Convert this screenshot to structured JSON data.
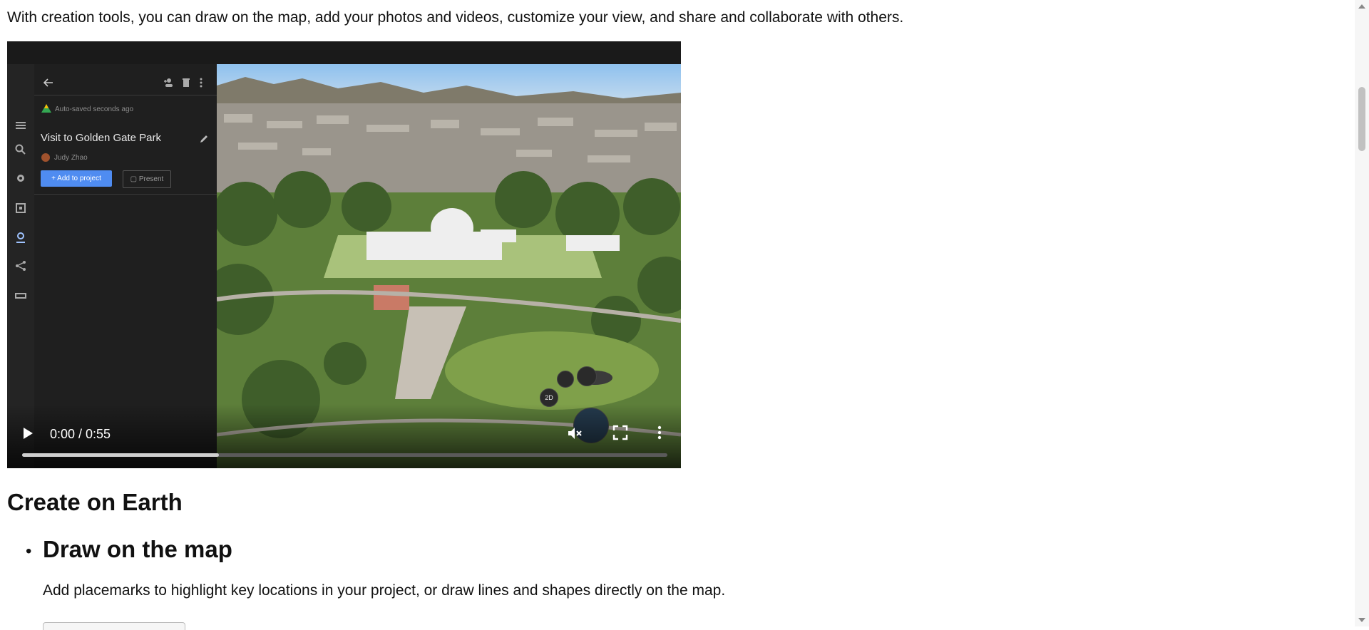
{
  "intro_text": "With creation tools, you can draw on the map, add your photos and videos, customize your view, and share and collaborate with others.",
  "video": {
    "autosave_text": "Auto-saved seconds ago",
    "project_title": "Visit to Golden Gate Park",
    "author": "Judy Zhao",
    "add_to_project_label": "Add to project",
    "present_label": "Present",
    "view_mode_label": "2D",
    "time_display": "0:00 / 0:55",
    "progress_buffered": 0.305,
    "muted": true
  },
  "section": {
    "heading": "Create on Earth",
    "items": [
      {
        "title": "Draw on the map",
        "description": "Add placemarks to highlight key locations in your project, or draw lines and shapes directly on the map."
      }
    ]
  },
  "colors": {
    "accent_button": "#4f8cf1",
    "player_background": "#1b1b1b"
  },
  "icons": [
    "menu-icon",
    "search-icon",
    "settings-icon",
    "layers-icon",
    "projects-icon",
    "share-icon",
    "ruler-icon",
    "back-arrow-icon",
    "add-person-icon",
    "trash-icon",
    "more-vert-icon",
    "edit-pencil-icon",
    "play-icon",
    "volume-muted-icon",
    "fullscreen-icon",
    "more-options-icon",
    "pegman-icon",
    "locate-icon",
    "globe-icon"
  ]
}
